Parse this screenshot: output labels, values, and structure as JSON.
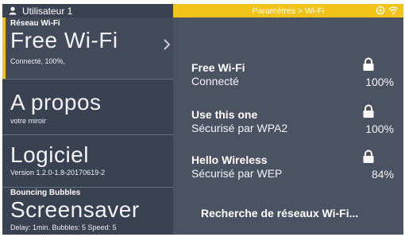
{
  "left_header": {
    "user_name": "Utilisateur 1",
    "icon": "user-icon"
  },
  "menu": {
    "wifi": {
      "label": "Réseau Wi-Fi",
      "title": "Free Wi-Fi",
      "sub": "Connecté, 100%,",
      "icon": "chevron-right-icon"
    },
    "about": {
      "title": "A propos",
      "sub": "votre miroir"
    },
    "software": {
      "title": "Logiciel",
      "sub": "Version 1.2.0-1.8-20170619-2"
    },
    "screensaver": {
      "label": "Bouncing Bubbles",
      "title": "Screensaver",
      "sub": "Delay: 1min.   Bubbles: 5   Speed: 5"
    }
  },
  "right_header": {
    "breadcrumb": "Paramètres > Wi-Fi",
    "icons": [
      "settings-icon",
      "wifi-icon"
    ]
  },
  "networks": [
    {
      "name": "Free Wi-Fi",
      "status": "Connecté",
      "signal": "100%",
      "icon": "lock-icon"
    },
    {
      "name": "Use this one",
      "status": "Sécurisé par WPA2",
      "signal": "100%",
      "icon": "lock-icon"
    },
    {
      "name": "Hello Wireless",
      "status": "Sécurisé par WEP",
      "signal": "84%",
      "icon": "lock-icon"
    }
  ],
  "scan_label": "Recherche de réseaux Wi-Fi...",
  "colors": {
    "accent": "#f2c318",
    "left_bg": "#3a4150",
    "right_bg": "#4b5363"
  }
}
